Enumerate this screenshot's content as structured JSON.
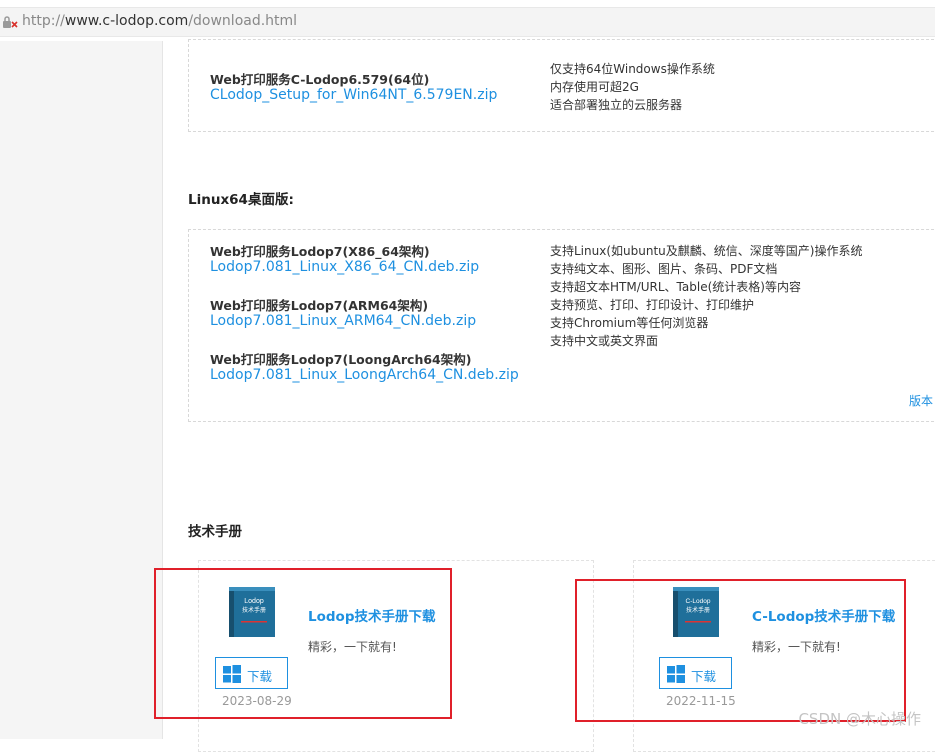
{
  "browser": {
    "url_scheme": "http://",
    "url_host": "www.c-lodop.com",
    "url_path": "/download.html"
  },
  "cloud_section": {
    "item_title": "Web打印服务C-Lodop6.579(64位)",
    "item_link": "CLodop_Setup_for_Win64NT_6.579EN.zip",
    "desc": [
      "仅支持64位Windows操作系统",
      "内存使用可超2G",
      "适合部署独立的云服务器"
    ]
  },
  "linux_section": {
    "heading": "Linux64桌面版:",
    "items": [
      {
        "title": "Web打印服务Lodop7(X86_64架构)",
        "link": "Lodop7.081_Linux_X86_64_CN.deb.zip"
      },
      {
        "title": "Web打印服务Lodop7(ARM64架构)",
        "link": "Lodop7.081_Linux_ARM64_CN.deb.zip"
      },
      {
        "title": "Web打印服务Lodop7(LoongArch64架构)",
        "link": "Lodop7.081_Linux_LoongArch64_CN.deb.zip"
      }
    ],
    "desc": [
      "支持Linux(如ubuntu及麒麟、统信、深度等国产)操作系统",
      "支持纯文本、图形、图片、条码、PDF文档",
      "支持超文本HTM/URL、Table(统计表格)等内容",
      "支持预览、打印、打印设计、打印维护",
      "支持Chromium等任何浏览器",
      "支持中文或英文界面"
    ],
    "version_link": "版本"
  },
  "manual_section": {
    "heading": "技术手册",
    "cards": [
      {
        "book_text": "Lodop\n技术手册",
        "title": "Lodop技术手册下载",
        "subtitle": "精彩，一下就有!",
        "button": "下载",
        "date": "2023-08-29"
      },
      {
        "book_text": "C-Lodop\n技术手册",
        "title": "C-Lodop技术手册下载",
        "subtitle": "精彩，一下就有!",
        "button": "下载",
        "date": "2022-11-15"
      }
    ]
  },
  "watermark": "CSDN @木心操作",
  "colors": {
    "link": "#1e90e0",
    "highlight_frame": "#e0202a",
    "book": "#1f6f9a"
  }
}
